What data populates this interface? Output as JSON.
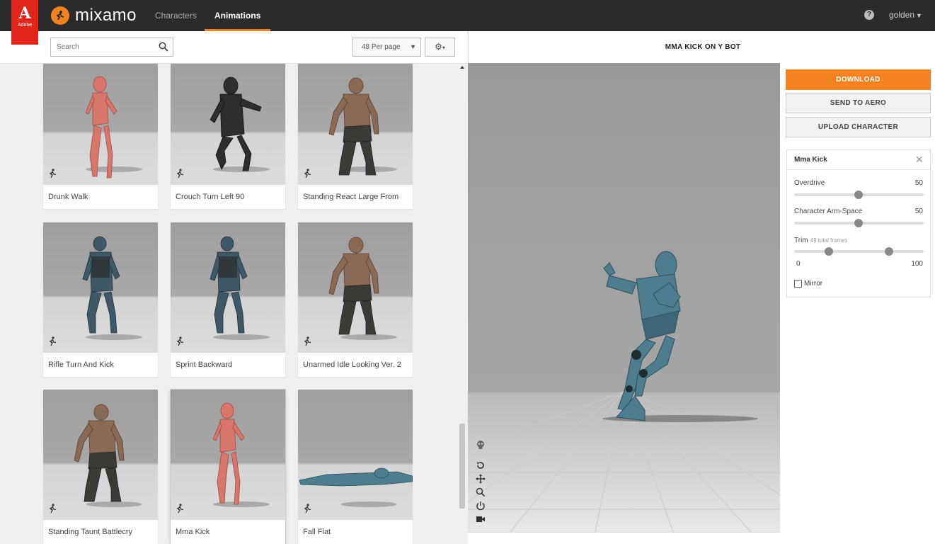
{
  "header": {
    "adobe_text": "Adobe",
    "brand": "mixamo",
    "tabs": [
      {
        "label": "Characters",
        "active": false
      },
      {
        "label": "Animations",
        "active": true
      }
    ],
    "user": "golden"
  },
  "toolbar": {
    "search_placeholder": "Search",
    "per_page": "48 Per page"
  },
  "animations": [
    {
      "label": "Drunk Walk",
      "figure": "red"
    },
    {
      "label": "Crouch Turn Left 90",
      "figure": "dark"
    },
    {
      "label": "Standing React Large From",
      "figure": "brute"
    },
    {
      "label": "Rifle Turn And Kick",
      "figure": "soldier"
    },
    {
      "label": "Sprint Backward",
      "figure": "soldier"
    },
    {
      "label": "Unarmed Idle Looking Ver. 2",
      "figure": "brute"
    },
    {
      "label": "Standing Taunt Battlecry",
      "figure": "brute"
    },
    {
      "label": "Mma Kick",
      "figure": "red",
      "selected": true
    },
    {
      "label": "Fall Flat",
      "figure": "blue-flat"
    }
  ],
  "viewer": {
    "title": "MMA KICK ON Y BOT"
  },
  "actions": {
    "download": "DOWNLOAD",
    "send_to_aero": "SEND TO AERO",
    "upload_character": "UPLOAD CHARACTER"
  },
  "settings": {
    "title": "Mma Kick",
    "overdrive_label": "Overdrive",
    "overdrive_value": "50",
    "arm_space_label": "Character Arm-Space",
    "arm_space_value": "50",
    "trim_label": "Trim",
    "trim_sub": "49 total frames",
    "trim_min": "0",
    "trim_max": "100",
    "mirror_label": "Mirror",
    "mirror_checked": false
  },
  "colors": {
    "accent": "#f58220",
    "adobe_red": "#e1251b",
    "topbar": "#2b2b2b",
    "ybot": "#4e7d8f"
  }
}
